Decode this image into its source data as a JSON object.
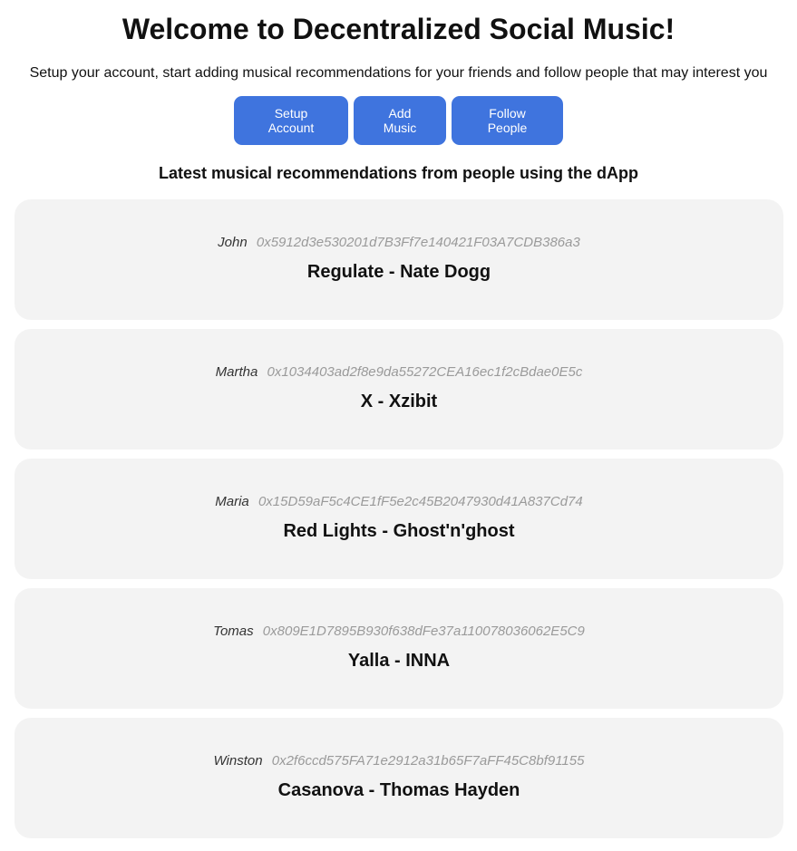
{
  "header": {
    "title": "Welcome to Decentralized Social Music!",
    "subtitle": "Setup your account, start adding musical recommendations for your friends and follow people that may interest you"
  },
  "actions": {
    "setup_label": "Setup Account",
    "add_label": "Add Music",
    "follow_label": "Follow People"
  },
  "feed": {
    "title": "Latest musical recommendations from people using the dApp",
    "items": [
      {
        "name": "John",
        "address": "0x5912d3e530201d7B3Ff7e140421F03A7CDB386a3",
        "song": "Regulate - Nate Dogg"
      },
      {
        "name": "Martha",
        "address": "0x1034403ad2f8e9da55272CEA16ec1f2cBdae0E5c",
        "song": "X - Xzibit"
      },
      {
        "name": "Maria",
        "address": "0x15D59aF5c4CE1fF5e2c45B2047930d41A837Cd74",
        "song": "Red Lights - Ghost'n'ghost"
      },
      {
        "name": "Tomas",
        "address": "0x809E1D7895B930f638dFe37a110078036062E5C9",
        "song": "Yalla - INNA"
      },
      {
        "name": "Winston",
        "address": "0x2f6ccd575FA71e2912a31b65F7aFF45C8bf91155",
        "song": "Casanova - Thomas Hayden"
      }
    ]
  },
  "colors": {
    "button_bg": "#3f74de",
    "card_bg": "#f3f3f3",
    "address_text": "#9a9a9a"
  }
}
